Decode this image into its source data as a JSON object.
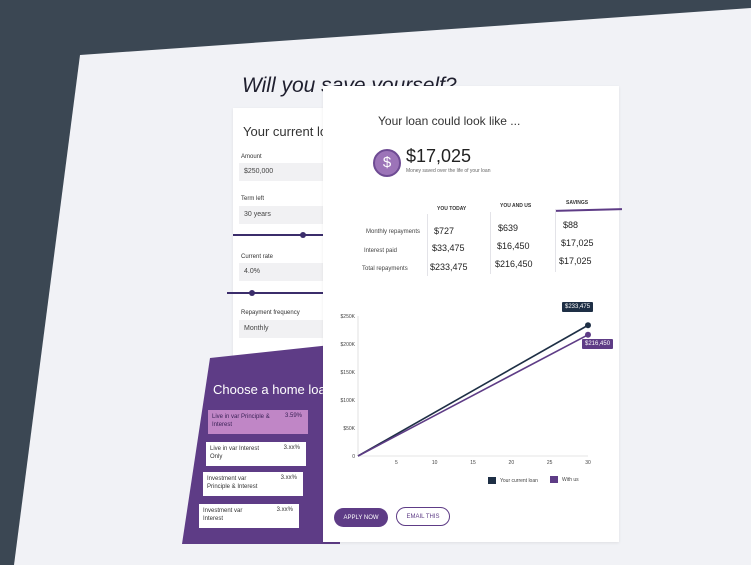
{
  "page": {
    "title": "Will you save yourself?"
  },
  "current_loan": {
    "heading": "Your current loan",
    "amount_label": "Amount",
    "amount_value": "$250,000",
    "term_label": "Term left",
    "term_value": "30 years",
    "term_slider_fraction": 0.7,
    "rate_label": "Current rate",
    "rate_value": "4.0%",
    "rate_slider_fraction": 0.25,
    "frequency_label": "Repayment frequency",
    "frequency_value": "Monthly"
  },
  "home_loans": {
    "heading": "Choose a home loan",
    "options": [
      {
        "name": "Live in var Principle & Interest",
        "rate": "3.59%"
      },
      {
        "name": "Live in var Interest Only",
        "rate": "3.xx%"
      },
      {
        "name": "Investment var Principle & Interest",
        "rate": "3.xx%"
      },
      {
        "name": "Investment var Interest",
        "rate": "3.xx%"
      }
    ]
  },
  "results": {
    "heading": "Your loan could look like ...",
    "savings_amount": "$17,025",
    "savings_caption": "Money saved over the life of your loan",
    "columns": [
      "YOU TODAY",
      "YOU AND US",
      "SAVINGS"
    ],
    "rows": [
      {
        "label": "Monthly repayments",
        "today": "$727",
        "with_us": "$639",
        "savings": "$88"
      },
      {
        "label": "Interest paid",
        "today": "$33,475",
        "with_us": "$16,450",
        "savings": "$17,025"
      },
      {
        "label": "Total repayments",
        "today": "$233,475",
        "with_us": "$216,450",
        "savings": "$17,025"
      }
    ]
  },
  "chart_data": {
    "type": "line",
    "x_ticks": [
      "0",
      "5",
      "10",
      "15",
      "20",
      "25",
      "30"
    ],
    "y_ticks": [
      "0",
      "$50K",
      "$100K",
      "$150K",
      "$200K",
      "$250K"
    ],
    "xlim": [
      0,
      30
    ],
    "ylim": [
      0,
      250000
    ],
    "series": [
      {
        "name": "Your current loan",
        "color": "#1e2f45",
        "x": [
          0,
          30
        ],
        "y": [
          0,
          233475
        ],
        "end_label": "$233,475"
      },
      {
        "name": "With us",
        "color": "#5e3c86",
        "x": [
          0,
          30
        ],
        "y": [
          0,
          216450
        ],
        "end_label": "$216,450"
      }
    ]
  },
  "buttons": {
    "apply": "APPLY NOW",
    "email": "EMAIL THIS"
  },
  "colors": {
    "brand_purple": "#5e3c86",
    "navy": "#1e2f45",
    "background": "#3b4753"
  }
}
